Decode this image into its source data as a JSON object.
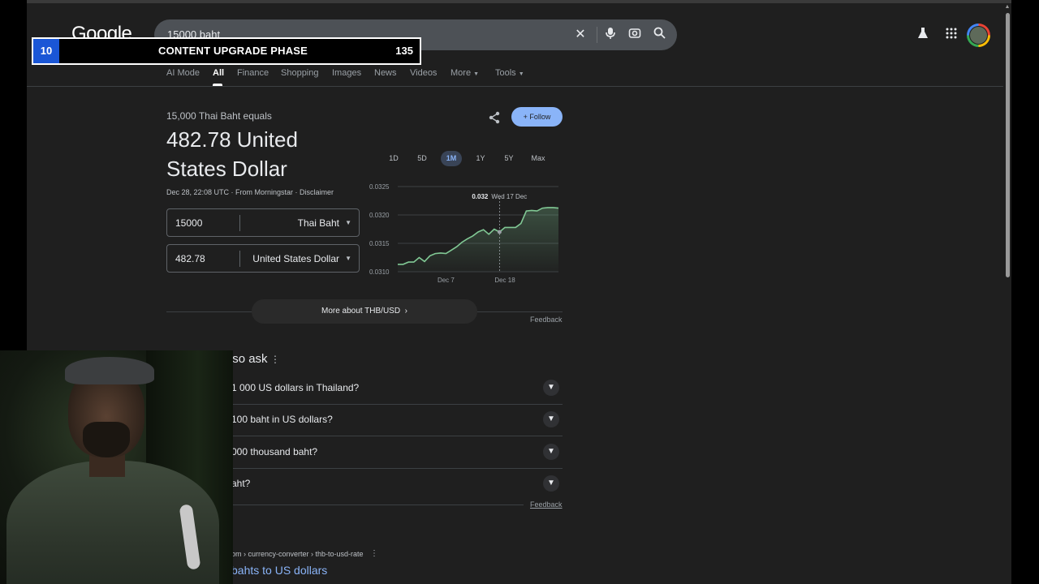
{
  "header": {
    "logo": "Google",
    "query": "15000 baht",
    "icons": [
      "clear-icon",
      "mic-icon",
      "lens-icon",
      "search-icon",
      "labs-icon",
      "apps-icon"
    ]
  },
  "overlay": {
    "number": "10",
    "title": "CONTENT UPGRADE PHASE",
    "count": "135"
  },
  "tabs": [
    {
      "label": "AI Mode"
    },
    {
      "label": "All"
    },
    {
      "label": "Finance"
    },
    {
      "label": "Shopping"
    },
    {
      "label": "Images"
    },
    {
      "label": "News"
    },
    {
      "label": "Videos"
    },
    {
      "label": "More"
    },
    {
      "label": "Tools"
    }
  ],
  "converter": {
    "equals_label": "15,000 Thai Baht equals",
    "result": "482.78 United States Dollar",
    "meta": "Dec 28, 22:08 UTC · From Morningstar · Disclaimer",
    "from_value": "15000",
    "from_currency": "Thai Baht",
    "to_value": "482.78",
    "to_currency": "United States Dollar",
    "follow_label": "Follow",
    "more_label": "More about THB/USD",
    "feedback": "Feedback"
  },
  "chart_ranges": [
    "1D",
    "5D",
    "1M",
    "1Y",
    "5Y",
    "Max"
  ],
  "active_range": "1M",
  "chart_data": {
    "type": "line",
    "x": [
      "Nov 28",
      "Nov 29",
      "Nov 30",
      "Dec 1",
      "Dec 2",
      "Dec 3",
      "Dec 4",
      "Dec 5",
      "Dec 6",
      "Dec 7",
      "Dec 8",
      "Dec 9",
      "Dec 10",
      "Dec 11",
      "Dec 12",
      "Dec 13",
      "Dec 14",
      "Dec 15",
      "Dec 16",
      "Dec 17",
      "Dec 18",
      "Dec 19",
      "Dec 20",
      "Dec 21",
      "Dec 22",
      "Dec 23",
      "Dec 24",
      "Dec 25",
      "Dec 26",
      "Dec 27",
      "Dec 28"
    ],
    "series": [
      {
        "values": [
          0.03113,
          0.03113,
          0.03117,
          0.03117,
          0.03125,
          0.03118,
          0.03128,
          0.03132,
          0.03133,
          0.03132,
          0.03138,
          0.03144,
          0.03152,
          0.03158,
          0.03163,
          0.0317,
          0.03174,
          0.03166,
          0.03175,
          0.0317,
          0.03178,
          0.03178,
          0.03178,
          0.03185,
          0.03207,
          0.03208,
          0.03207,
          0.03212,
          0.03213,
          0.03213,
          0.03212
        ]
      }
    ],
    "yticks": [
      "0.0325",
      "0.0320",
      "0.0315",
      "0.0310"
    ],
    "xticks": [
      "Dec 7",
      "Dec 18"
    ],
    "ylim": [
      0.031,
      0.0325
    ],
    "tooltip": {
      "value": "0.032",
      "date": "Wed 17 Dec"
    },
    "line_color": "#81c995"
  },
  "paa": {
    "title": "'s also ask",
    "questions": [
      {
        "text": "1 000 US dollars in Thailand?"
      },
      {
        "text": "100 baht in US dollars?"
      },
      {
        "text": "000 thousand baht?"
      },
      {
        "text": "aht?"
      }
    ],
    "feedback": "Feedback"
  },
  "result_item": {
    "cite": "om › currency-converter › thb-to-usd-rate",
    "title": "bahts to US dollars"
  }
}
